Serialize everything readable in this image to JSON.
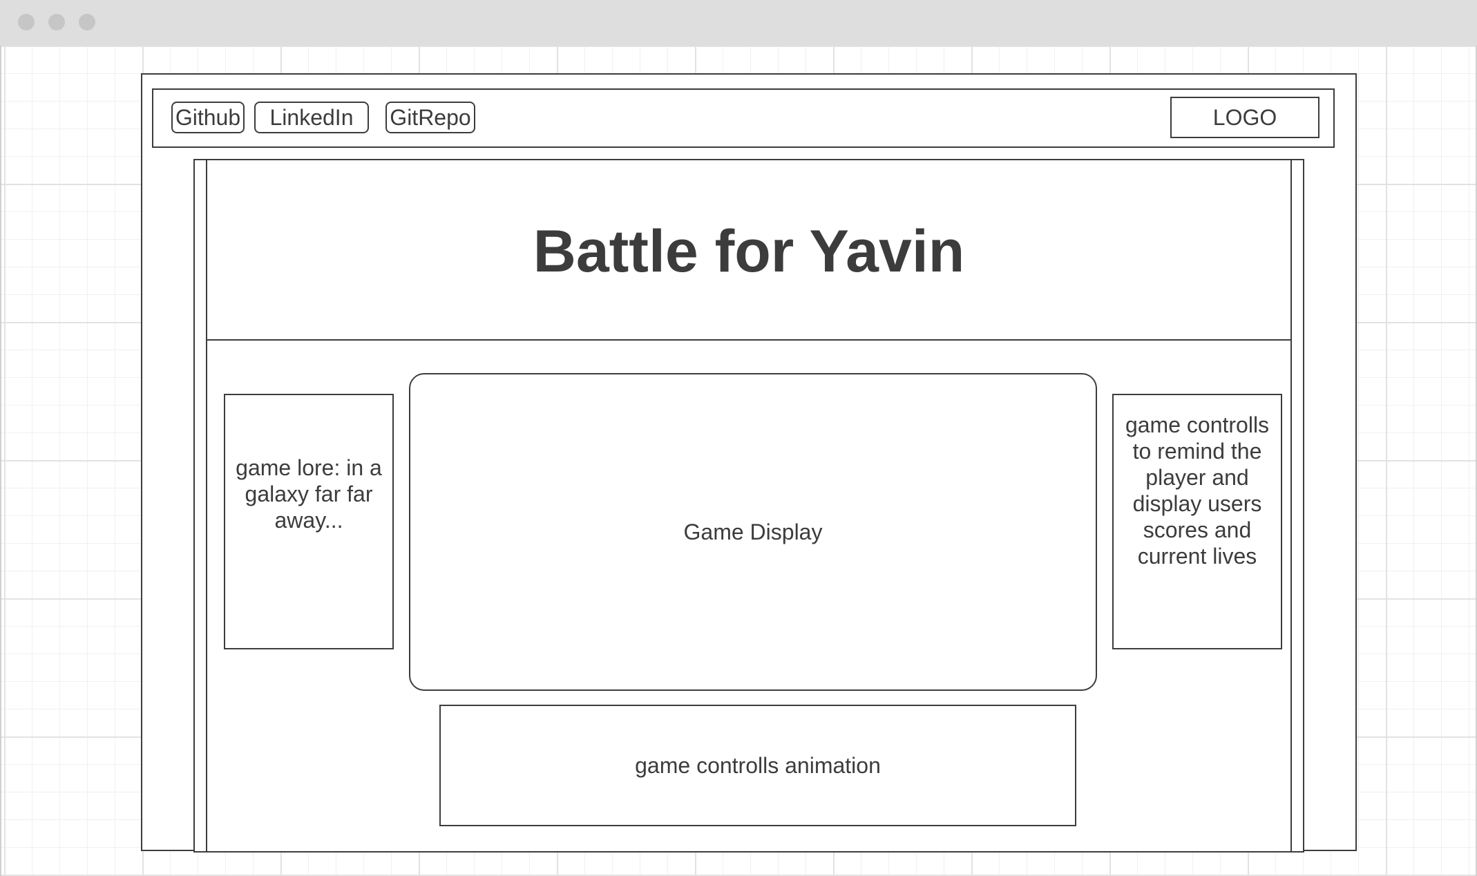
{
  "nav": {
    "buttons": [
      "Github",
      "LinkedIn",
      "GitRepo"
    ],
    "logo": "LOGO"
  },
  "header": {
    "title": "Battle for Yavin"
  },
  "main": {
    "lore": "game lore: in a galaxy far far away...",
    "display": "Game Display",
    "controls_info": "game controlls to remind the player and display users scores and current lives",
    "controls_animation": "game controlls animation"
  },
  "colors": {
    "stroke": "#3c3c3c",
    "titlebar": "#dedede"
  }
}
